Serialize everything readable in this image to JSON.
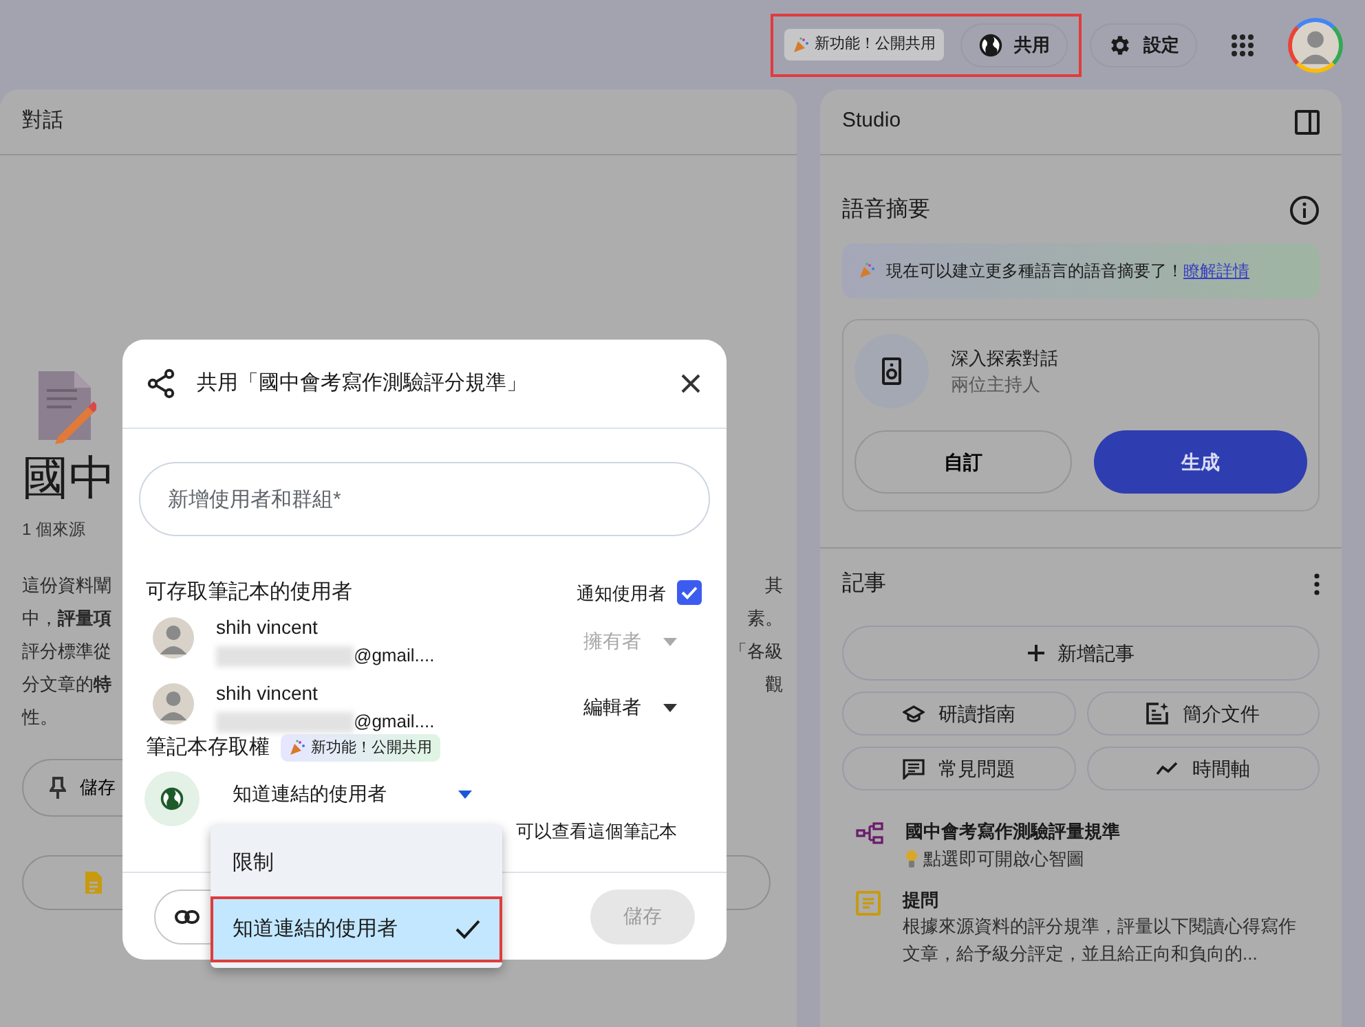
{
  "top_bar": {
    "highlighted": true,
    "new_feature_badge": "新功能！公開共用",
    "share_button": "共用",
    "settings_button": "設定"
  },
  "chat_panel": {
    "title": "對話",
    "notebook_title": "國中",
    "source_count": "1 個來源",
    "summary_lines": [
      {
        "left": "這份資料闡",
        "right": "其"
      },
      {
        "left": "中，**評量項**",
        "right": "素。"
      },
      {
        "left": "評分標準從",
        "right": "「各級"
      },
      {
        "left": "分文章的**特**",
        "right": "觀"
      },
      {
        "left": "性。"
      }
    ],
    "pin_button": "儲存"
  },
  "studio_panel": {
    "title": "Studio",
    "audio_title": "語音摘要",
    "banner_text": "現在可以建立更多種語言的語音摘要了！",
    "banner_link": "瞭解詳情",
    "audio_card": {
      "title": "深入探索對話",
      "subtitle": "兩位主持人",
      "customize_button": "自訂",
      "generate_button": "生成"
    },
    "notes_title": "記事",
    "add_note_button": "新增記事",
    "tools": [
      {
        "kind": "guide",
        "label": "研讀指南"
      },
      {
        "kind": "briefing",
        "label": "簡介文件"
      },
      {
        "kind": "faq",
        "label": "常見問題"
      },
      {
        "kind": "timeline",
        "label": "時間軸"
      }
    ],
    "notes": [
      {
        "kind": "mindmap",
        "title": "國中會考寫作測驗評量規準",
        "text": "點選即可開啟心智圖"
      },
      {
        "kind": "note",
        "title": "提問",
        "text": "根據來源資料的評分規準，評量以下閱讀心得寫作文章，給予級分評定，並且給正向和負向的..."
      }
    ]
  },
  "share_dialog": {
    "title": "共用「國中會考寫作測驗評分規準」",
    "input_placeholder": "新增使用者和群組*",
    "people_heading": "可存取筆記本的使用者",
    "notify_label": "通知使用者",
    "notify_checked": true,
    "users": [
      {
        "name": "shih vincent",
        "email": "@gmail....",
        "role": "擁有者",
        "disabled": true
      },
      {
        "name": "shih vincent",
        "email": "@gmail....",
        "role": "編輯者",
        "disabled": false
      }
    ],
    "access_heading": "筆記本存取權",
    "access_badge": "新功能！公開共用",
    "access_value": "知道連結的使用者",
    "access_description": "可以查看這個筆記本",
    "save_button": "儲存",
    "save_disabled": true
  },
  "access_menu": {
    "items": [
      {
        "label": "限制",
        "selected": false,
        "highlighted": false
      },
      {
        "label": "知道連結的使用者",
        "selected": true,
        "highlighted": true
      }
    ]
  }
}
